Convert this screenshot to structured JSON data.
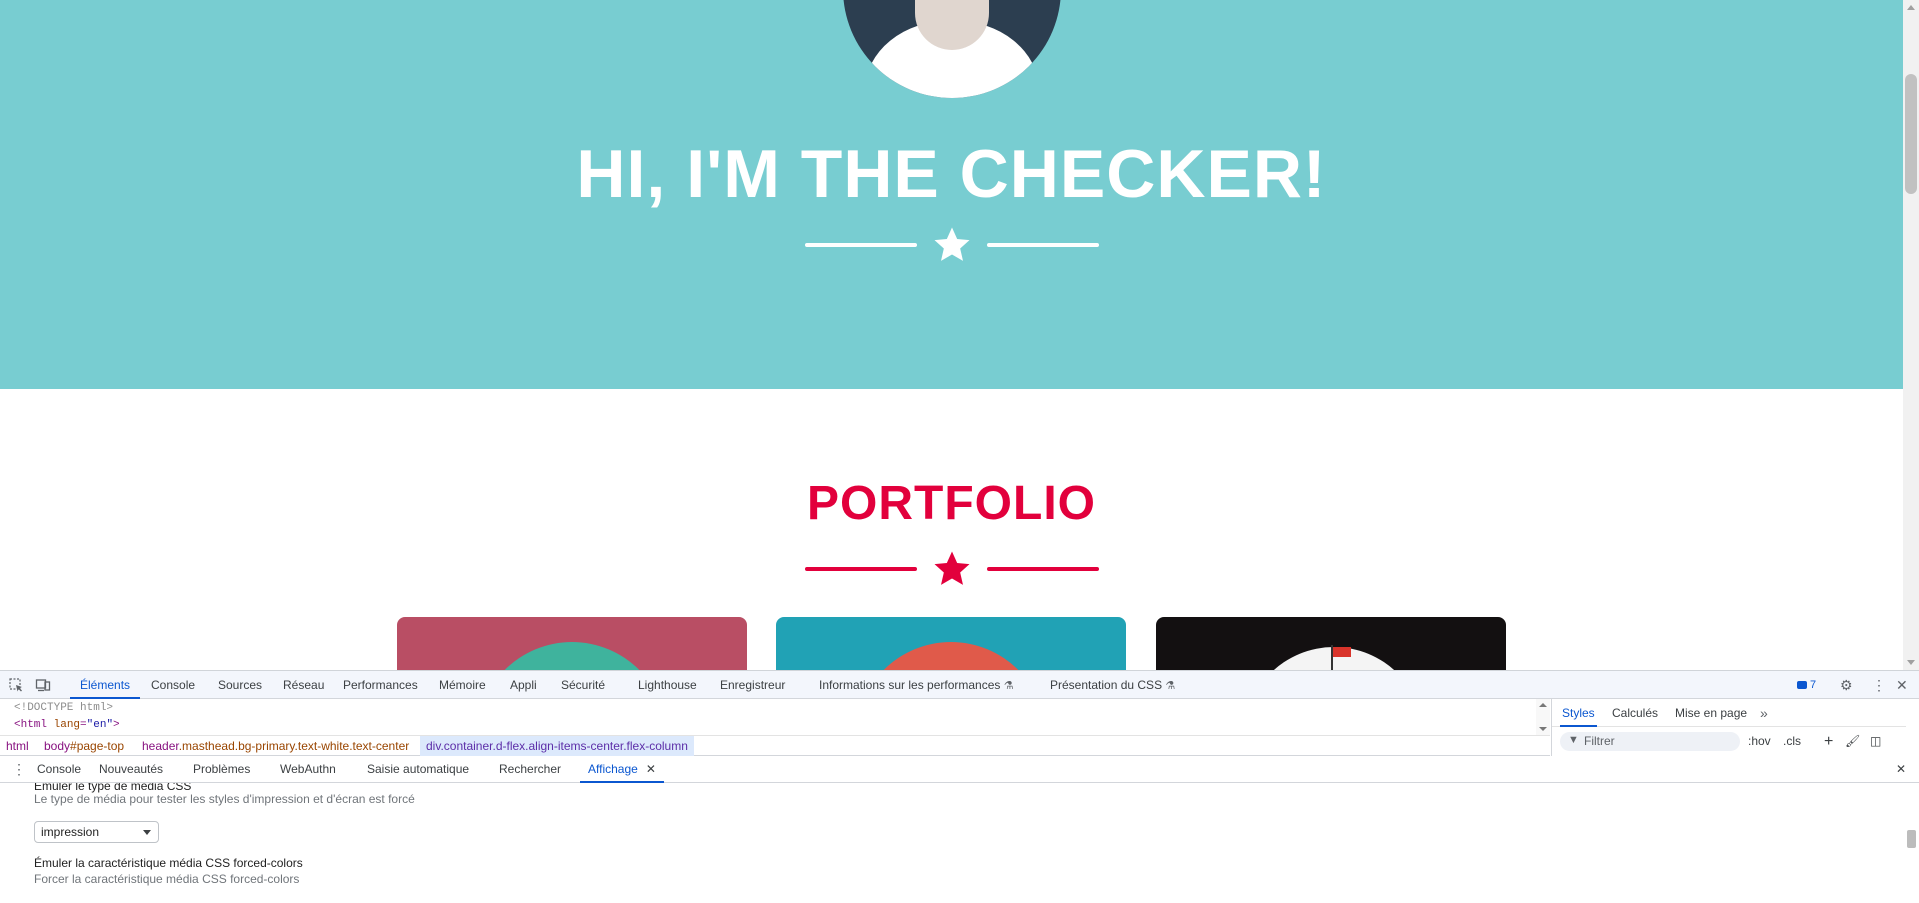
{
  "page": {
    "masthead_heading": "HI, I'M THE CHECKER!",
    "portfolio_heading": "PORTFOLIO",
    "colors": {
      "masthead_bg": "#78cdd1",
      "accent": "#e2003c"
    }
  },
  "devtools": {
    "tabs": [
      "Éléments",
      "Console",
      "Sources",
      "Réseau",
      "Performances",
      "Mémoire",
      "Appli",
      "Sécurité",
      "Lighthouse",
      "Enregistreur",
      "Informations sur les performances",
      "Présentation du CSS"
    ],
    "active_tab": "Éléments",
    "issues_count": "7",
    "dom": {
      "doctype": "<!DOCTYPE html>",
      "html_open": "<html",
      "html_attr_name": "lang",
      "html_attr_eq": "=",
      "html_attr_value": "\"en\"",
      "html_close": ">"
    },
    "breadcrumb": {
      "html": "html",
      "body_tag": "body",
      "body_rest": "#page-top",
      "header_tag": "header",
      "header_rest": ".masthead.bg-primary.text-white.text-center",
      "div_tag": "div",
      "div_rest": ".container.d-flex.align-items-center.flex-column"
    },
    "styles_tabs": [
      "Styles",
      "Calculés",
      "Mise en page"
    ],
    "filter_placeholder": "Filtrer",
    "hov": ":hov",
    "cls": ".cls",
    "drawer_tabs": [
      "Console",
      "Nouveautés",
      "Problèmes",
      "WebAuthn",
      "Saisie automatique",
      "Rechercher",
      "Affichage"
    ],
    "drawer_active": "Affichage",
    "rendering": {
      "cut_heading": "Émuler le type de média CSS",
      "media_desc": "Le type de média pour tester les styles d'impression et d'écran est forcé",
      "media_value": "impression",
      "forced_title": "Émuler la caractéristique média CSS forced-colors",
      "forced_desc": "Forcer la caractéristique média CSS forced-colors"
    }
  }
}
